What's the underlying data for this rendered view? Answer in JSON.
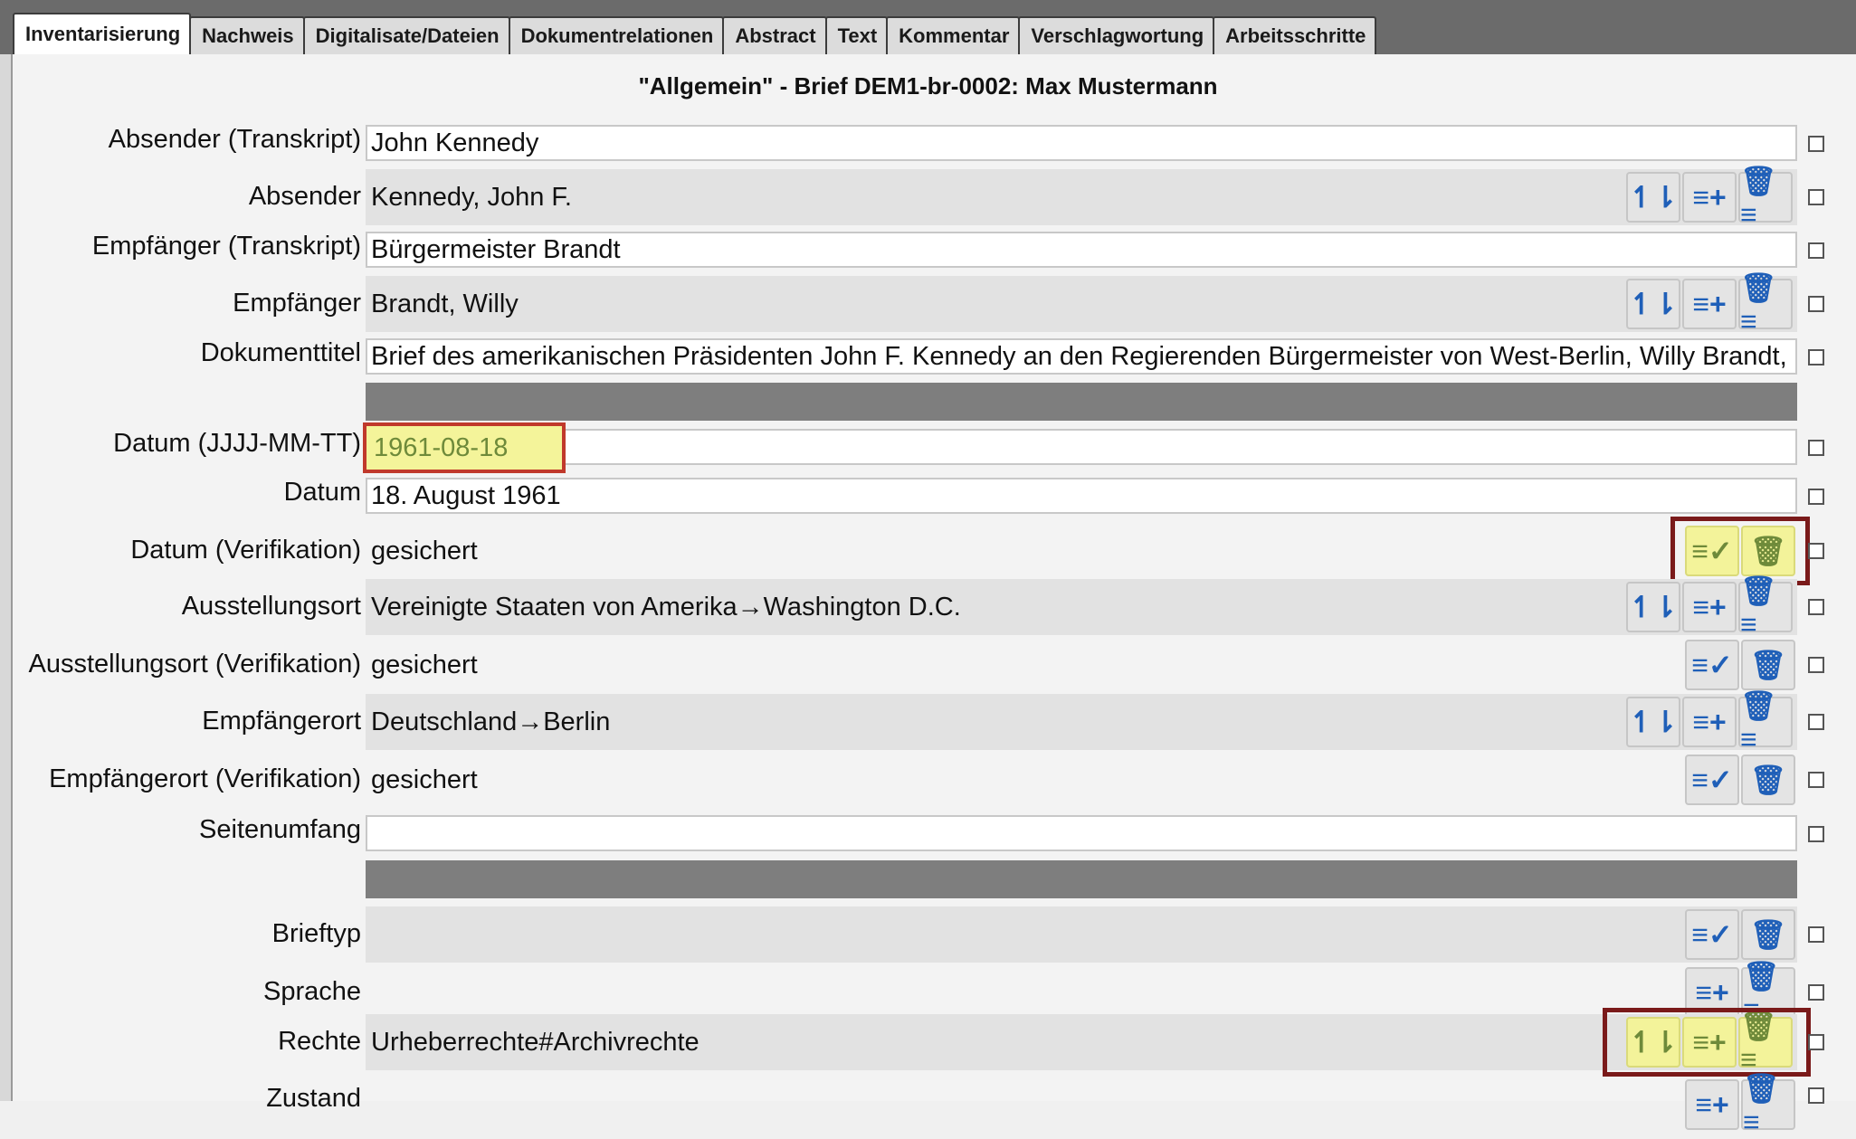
{
  "tabs": [
    "Inventarisierung",
    "Nachweis",
    "Digitalisate/Dateien",
    "Dokumentrelationen",
    "Abstract",
    "Text",
    "Kommentar",
    "Verschlagwortung",
    "Arbeitsschritte"
  ],
  "heading": "\"Allgemein\" - Brief DEM1-br-0002: Max Mustermann",
  "rows": {
    "r1": {
      "label": "Absender (Transkript)",
      "value": "John Kennedy"
    },
    "r2": {
      "label": "Absender",
      "value": "Kennedy, John F."
    },
    "r3": {
      "label": "Empfänger (Transkript)",
      "value": "Bürgermeister Brandt"
    },
    "r4": {
      "label": "Empfänger",
      "value": "Brandt, Willy"
    },
    "r5": {
      "label": "Dokumenttitel",
      "value": "Brief des amerikanischen Präsidenten John F. Kennedy an den Regierenden Bürgermeister von West-Berlin, Willy Brandt,"
    },
    "r6": {
      "label": "Datum (JJJJ-MM-TT)",
      "value": "1961-08-18"
    },
    "r7": {
      "label": "Datum",
      "value": "18. August 1961"
    },
    "r8": {
      "label": "Datum (Verifikation)",
      "value": "gesichert"
    },
    "r9": {
      "label": "Ausstellungsort",
      "value": "Vereinigte Staaten von Amerika→Washington D.C."
    },
    "r10": {
      "label": "Ausstellungsort (Verifikation)",
      "value": "gesichert"
    },
    "r11": {
      "label": "Empfängerort",
      "value": "Deutschland→Berlin"
    },
    "r12": {
      "label": "Empfängerort (Verifikation)",
      "value": "gesichert"
    },
    "r13": {
      "label": "Seitenumfang",
      "value": ""
    },
    "r14": {
      "label": "Brieftyp",
      "value": ""
    },
    "r15": {
      "label": "Sprache",
      "value": ""
    },
    "r16": {
      "label": "Rechte",
      "value": "Urheberrechte#Archivrechte"
    },
    "r17": {
      "label": "Zustand",
      "value": ""
    }
  },
  "icons": {
    "sort": "↿⇂",
    "add": "≡+",
    "verify": "≡✓",
    "delete": "🗑",
    "delete_list": "🗑≡"
  },
  "colors": {
    "highlight": "#f3f39a",
    "highlight_border": "#7a1a1a",
    "icon_blue": "#1f5fb8"
  }
}
